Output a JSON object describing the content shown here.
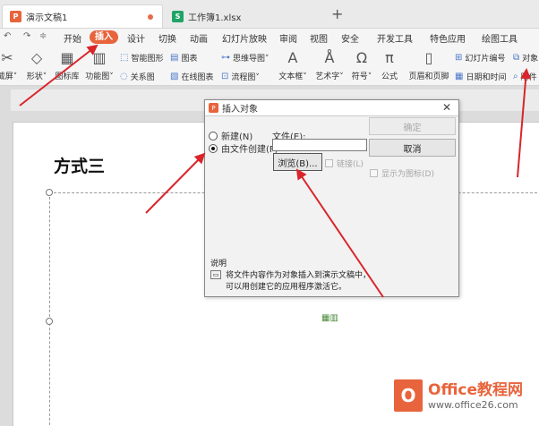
{
  "tabs": [
    {
      "label": "演示文稿1",
      "icon": "P",
      "color": "#e8643c"
    },
    {
      "label": "工作簿1.xlsx",
      "icon": "S",
      "color": "#21a366"
    }
  ],
  "new_tab": "+",
  "menu": [
    "开始",
    "插入",
    "设计",
    "切换",
    "动画",
    "幻灯片放映",
    "审阅",
    "视图",
    "安全",
    "开发工具",
    "特色应用",
    "绘图工具"
  ],
  "active_menu": "插入",
  "quick_access": [
    "↶",
    "↷",
    "≑"
  ],
  "ribbon": {
    "large": [
      {
        "label": "截屏˅",
        "icon": "scissors-icon"
      },
      {
        "label": "形状˅",
        "icon": "shapes-icon"
      },
      {
        "label": "图标库",
        "icon": "icon-library-icon"
      },
      {
        "label": "功能图˅",
        "icon": "function-chart-icon"
      },
      {
        "label": "文本框˅",
        "icon": "textbox-icon"
      },
      {
        "label": "艺术字˅",
        "icon": "wordart-icon"
      },
      {
        "label": "符号˅",
        "icon": "symbol-icon"
      },
      {
        "label": "公式",
        "icon": "formula-icon"
      },
      {
        "label": "页眉和页脚",
        "icon": "header-footer-icon"
      }
    ],
    "small": [
      {
        "label": "智能图形",
        "icon": "smartart-icon"
      },
      {
        "label": "关系图",
        "icon": "relation-icon"
      },
      {
        "label": "图表",
        "icon": "chart-icon"
      },
      {
        "label": "在线图表",
        "icon": "online-chart-icon"
      },
      {
        "label": "思维导图˅",
        "icon": "mindmap-icon"
      },
      {
        "label": "流程图˅",
        "icon": "flowchart-icon"
      },
      {
        "label": "幻灯片编号",
        "icon": "slide-number-icon"
      },
      {
        "label": "日期和时间",
        "icon": "datetime-icon"
      },
      {
        "label": "对象",
        "icon": "object-icon"
      },
      {
        "label": "附件",
        "icon": "attachment-icon"
      }
    ]
  },
  "slide": {
    "title": "方式三"
  },
  "dialog": {
    "title": "插入对象",
    "radio_new": "新建(N)",
    "radio_from_file": "由文件创建(F)",
    "file_label": "文件(E):",
    "file_value": "",
    "browse": "浏览(B)...",
    "link": "链接(L)",
    "ok": "确定",
    "cancel": "取消",
    "show_as_icon": "显示为图标(D)",
    "desc_label": "说明",
    "desc_text_1": "将文件内容作为对象插入到演示文稿中，",
    "desc_text_2": "可以用创建它的应用程序激活它。"
  },
  "watermark": {
    "logo": "O",
    "line1": "Office教程网",
    "line2": "www.office26.com"
  },
  "colors": {
    "accent": "#e8643c",
    "arrow": "#d9252a"
  }
}
